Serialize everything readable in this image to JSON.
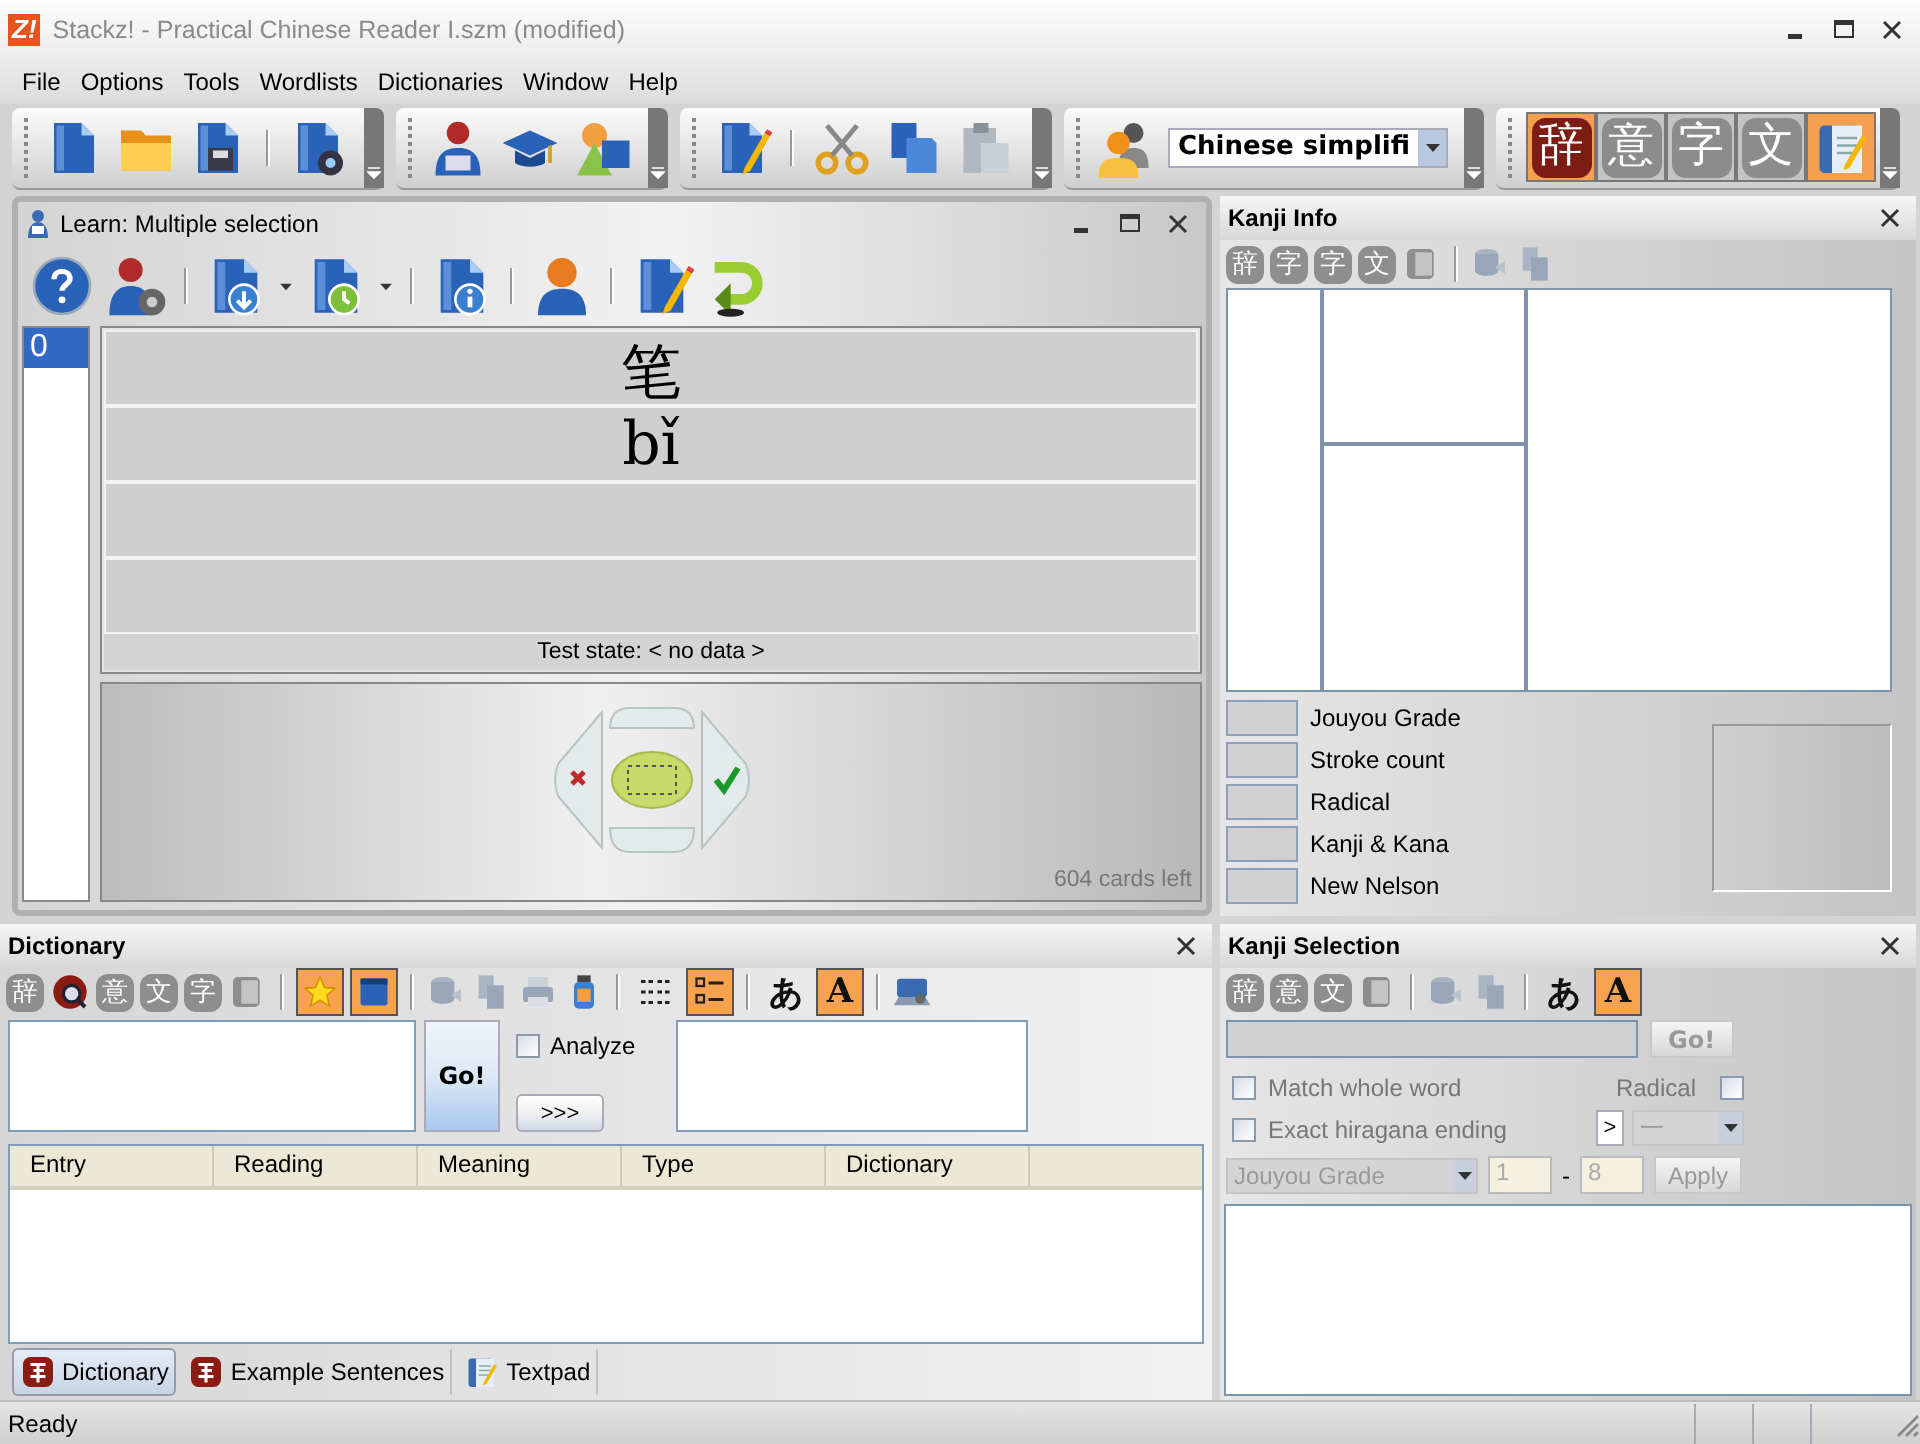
{
  "window": {
    "logo": "Z!",
    "title": "Stackz! - Practical Chinese Reader I.szm (modified)"
  },
  "menu": [
    "File",
    "Options",
    "Tools",
    "Wordlists",
    "Dictionaries",
    "Window",
    "Help"
  ],
  "main_toolbar": {
    "language": "Chinese simplifi",
    "modes": [
      {
        "kind": "glyph",
        "label": "辞",
        "selected": true
      },
      {
        "kind": "glyph",
        "label": "意",
        "selected": false
      },
      {
        "kind": "glyph",
        "label": "字",
        "selected": false
      },
      {
        "kind": "glyph",
        "label": "文",
        "selected": false
      },
      {
        "kind": "notebook",
        "selected": true
      }
    ]
  },
  "learn": {
    "title": "Learn: Multiple selection",
    "queue": [
      {
        "label": "0",
        "selected": true
      }
    ],
    "card_rows": [
      "笔",
      "bǐ"
    ],
    "test_state": "Test state: < no data >",
    "cards_left": "604 cards left"
  },
  "dictionary": {
    "title": "Dictionary",
    "sources": [
      {
        "kind": "glyph",
        "label": "辞"
      },
      {
        "kind": "search"
      },
      {
        "kind": "glyph",
        "label": "意"
      },
      {
        "kind": "glyph",
        "label": "文"
      },
      {
        "kind": "glyph",
        "label": "字"
      },
      {
        "kind": "notebook"
      }
    ],
    "toggles": [
      {
        "kind": "star",
        "selected": true
      },
      {
        "kind": "window",
        "selected": true
      }
    ],
    "views": [
      {
        "kind": "columns",
        "selected": false
      },
      {
        "kind": "list",
        "selected": true
      }
    ],
    "scripts": [
      {
        "label": "あ",
        "selected": false
      },
      {
        "label": "A",
        "selected": true
      }
    ],
    "go": "Go!",
    "analyze": {
      "label": "Analyze",
      "checked": false
    },
    "more": ">>>",
    "columns": [
      "Entry",
      "Reading",
      "Meaning",
      "Type",
      "Dictionary"
    ],
    "tabs": [
      {
        "kind": "tile",
        "label": "Dictionary",
        "selected": true
      },
      {
        "kind": "tile",
        "label": "Example Sentences",
        "selected": false
      },
      {
        "kind": "notebook",
        "label": "Textpad",
        "selected": false
      }
    ]
  },
  "kanji_info": {
    "title": "Kanji Info",
    "sources": [
      {
        "kind": "glyph",
        "label": "辞"
      },
      {
        "kind": "glyph",
        "label": "字"
      },
      {
        "kind": "glyph",
        "label": "字"
      },
      {
        "kind": "glyph",
        "label": "文"
      },
      {
        "kind": "notebook"
      }
    ],
    "fields": [
      "Jouyou Grade",
      "Stroke count",
      "Radical",
      "Kanji & Kana",
      "New Nelson"
    ]
  },
  "kanji_selection": {
    "title": "Kanji Selection",
    "sources": [
      {
        "kind": "glyph",
        "label": "辞"
      },
      {
        "kind": "glyph",
        "label": "意"
      },
      {
        "kind": "glyph",
        "label": "文"
      },
      {
        "kind": "notebook"
      }
    ],
    "scripts": [
      {
        "label": "あ",
        "selected": false
      },
      {
        "label": "A",
        "selected": true
      }
    ],
    "go": "Go!",
    "options": [
      {
        "label": "Match whole word",
        "checked": false
      },
      {
        "label": "Exact hiragana ending",
        "checked": false
      }
    ],
    "radical": {
      "label": "Radical",
      "checked": false
    },
    "radical_next": ">",
    "radical_value": "一",
    "filter": "Jouyou Grade",
    "range_from": "1",
    "range_sep": "-",
    "range_to": "8",
    "apply": "Apply"
  },
  "status_bar": {
    "text": "Ready"
  }
}
